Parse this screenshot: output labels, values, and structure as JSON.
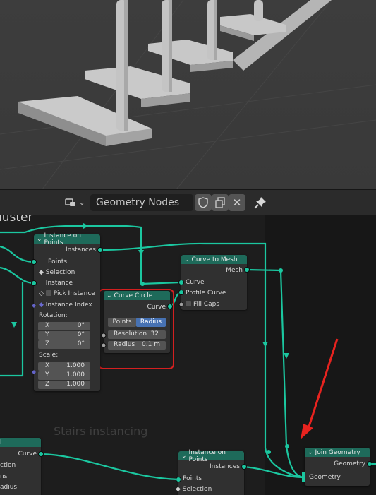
{
  "header": {
    "editor_type_icon": "geometry-nodes-editor-icon",
    "tree_name": "Geometry Nodes",
    "icons": [
      "shield-icon",
      "copy-icon",
      "close-icon",
      "pin-icon"
    ],
    "close_glyph": "✕"
  },
  "frames": {
    "baluster_label": "luster",
    "stairs_label": "Stairs instancing"
  },
  "nodes": {
    "instance_on_points_top": {
      "title": "Instance on Points",
      "output_instances": "Instances",
      "input_points": "Points",
      "input_selection": "Selection",
      "input_instance": "Instance",
      "pick_instance": "Pick Instance",
      "instance_index": "Instance Index",
      "rotation_label": "Rotation:",
      "rotation": [
        {
          "axis": "X",
          "value": "0°"
        },
        {
          "axis": "Y",
          "value": "0°"
        },
        {
          "axis": "Z",
          "value": "0°"
        }
      ],
      "scale_label": "Scale:",
      "scale": [
        {
          "axis": "X",
          "value": "1.000"
        },
        {
          "axis": "Y",
          "value": "1.000"
        },
        {
          "axis": "Z",
          "value": "1.000"
        }
      ]
    },
    "curve_circle": {
      "title": "Curve Circle",
      "output_curve": "Curve",
      "mode_points": "Points",
      "mode_radius": "Radius",
      "resolution_label": "Resolution",
      "resolution_value": "32",
      "radius_label": "Radius",
      "radius_value": "0.1 m"
    },
    "curve_to_mesh": {
      "title": "Curve to Mesh",
      "output_mesh": "Mesh",
      "input_curve": "Curve",
      "input_profile": "Profile Curve",
      "fill_caps": "Fill Caps"
    },
    "curve_partial_left": {
      "title_fragment": "l",
      "output_curve": "Curve",
      "rows": [
        "ction",
        "ns",
        "adius"
      ]
    },
    "instance_on_points_bottom": {
      "title": "Instance on Points",
      "output_instances": "Instances",
      "input_points": "Points",
      "input_selection": "Selection"
    },
    "join_geometry": {
      "title": "Join Geometry",
      "output_geometry": "Geometry",
      "input_geometry": "Geometry"
    }
  },
  "colors": {
    "geometry_socket": "#00d6a3",
    "node_header": "#1e6a5a",
    "highlight_box": "#d42020",
    "arrow": "#e8231f",
    "radius_active": "#4772b3"
  }
}
